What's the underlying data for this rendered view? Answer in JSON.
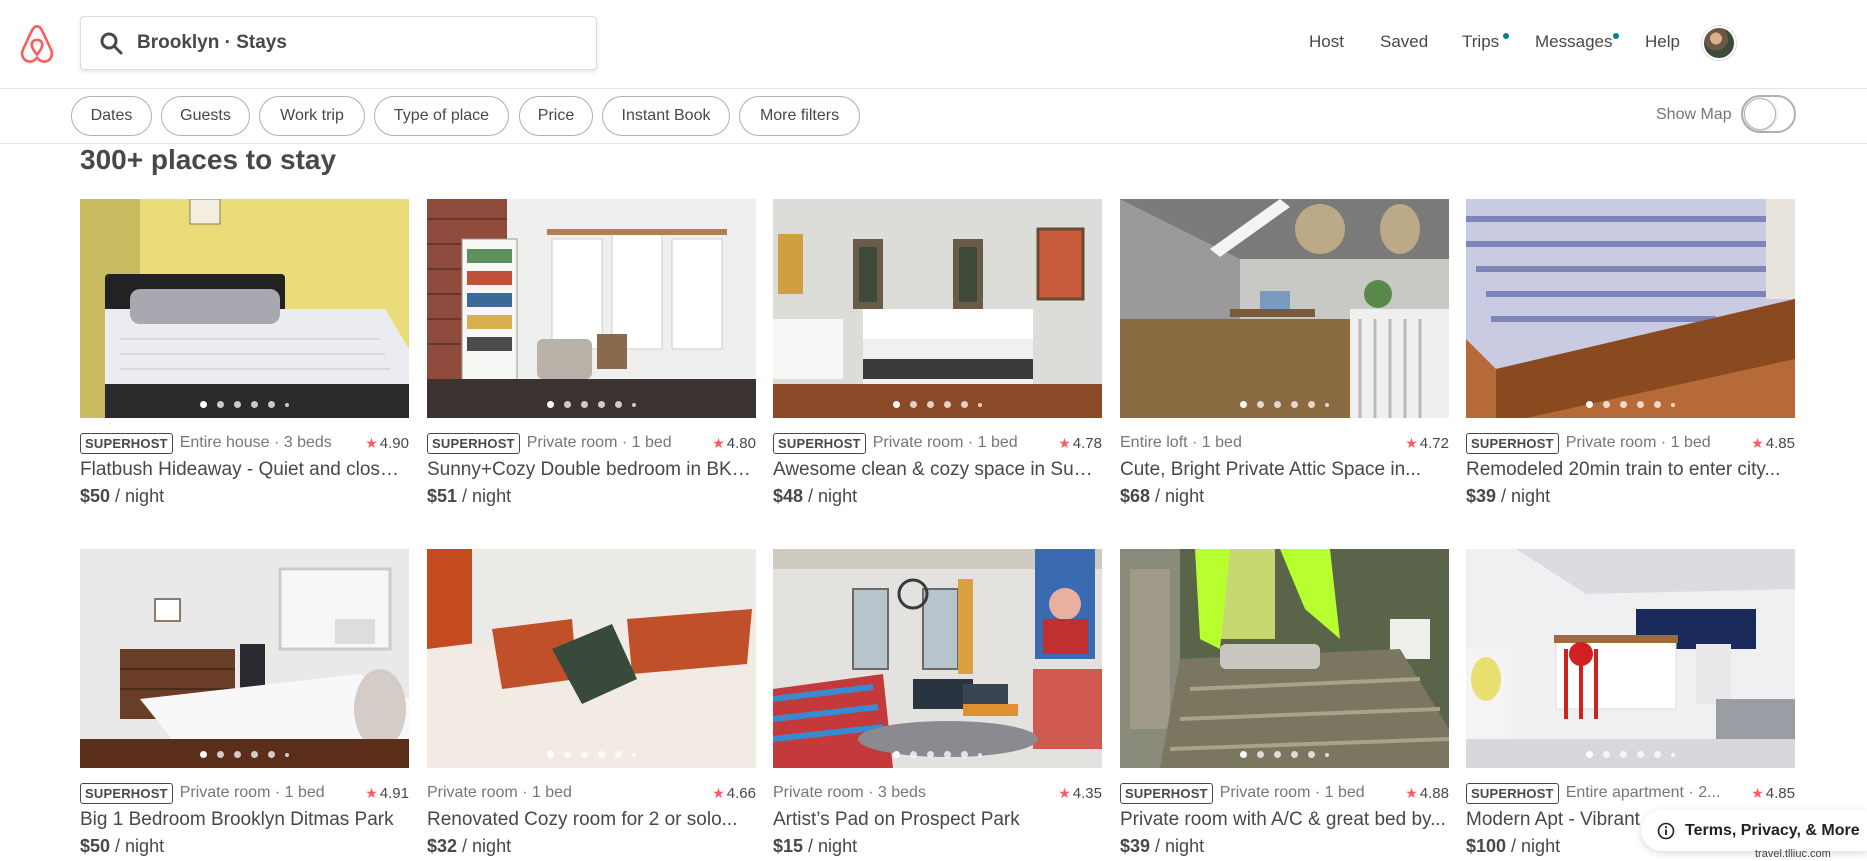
{
  "header": {
    "search_value": "Brooklyn · Stays",
    "nav": [
      {
        "label": "Host",
        "dot": false
      },
      {
        "label": "Saved",
        "dot": false
      },
      {
        "label": "Trips",
        "dot": true
      },
      {
        "label": "Messages",
        "dot": true
      },
      {
        "label": "Help",
        "dot": false
      }
    ]
  },
  "filters": {
    "pills": [
      "Dates",
      "Guests",
      "Work trip",
      "Type of place",
      "Price",
      "Instant Book",
      "More filters"
    ],
    "show_map_label": "Show Map",
    "show_map_on": false
  },
  "main": {
    "heading": "300+ places to stay",
    "listings": [
      {
        "superhost": true,
        "type": "Entire house · 3 beds",
        "rating": "4.90",
        "title": "Flatbush Hideaway - Quiet and close t...",
        "price": "$50",
        "per": " / night"
      },
      {
        "superhost": true,
        "type": "Private room · 1 bed",
        "rating": "4.80",
        "title": "Sunny+Cozy Double bedroom in BKLYN!",
        "price": "$51",
        "per": " / night"
      },
      {
        "superhost": true,
        "type": "Private room · 1 bed",
        "rating": "4.78",
        "title": "Awesome clean & cozy space in Sunse...",
        "price": "$48",
        "per": " / night"
      },
      {
        "superhost": false,
        "type": "Entire loft · 1 bed",
        "rating": "4.72",
        "title": "Cute, Bright Private Attic Space in...",
        "price": "$68",
        "per": " / night"
      },
      {
        "superhost": true,
        "type": "Private room · 1 bed",
        "rating": "4.85",
        "title": "Remodeled 20min train to enter city...",
        "price": "$39",
        "per": " / night"
      },
      {
        "superhost": true,
        "type": "Private room · 1 bed",
        "rating": "4.91",
        "title": "Big 1 Bedroom Brooklyn Ditmas Park",
        "price": "$50",
        "per": " / night"
      },
      {
        "superhost": false,
        "type": "Private room · 1 bed",
        "rating": "4.66",
        "title": "Renovated Cozy room for 2 or solo...",
        "price": "$32",
        "per": " / night"
      },
      {
        "superhost": false,
        "type": "Private room · 3 beds",
        "rating": "4.35",
        "title": "Artist’s Pad on Prospect Park",
        "price": "$15",
        "per": " / night"
      },
      {
        "superhost": true,
        "type": "Private room · 1 bed",
        "rating": "4.88",
        "title": "Private room with A/C & great bed by...",
        "price": "$39",
        "per": " / night"
      },
      {
        "superhost": true,
        "type": "Entire apartment · 2...",
        "rating": "4.85",
        "title": "Modern Apt - Vibrant",
        "price": "$100",
        "per": " / night"
      }
    ],
    "superhost_label": "SUPERHOST"
  },
  "footer": {
    "terms_label": "Terms, Privacy, & More",
    "watermark": "travel.tlliuc.com"
  },
  "colors": {
    "brand": "#ff5a5f",
    "nav_dot": "#008489",
    "text": "#484848",
    "muted": "#767676"
  }
}
